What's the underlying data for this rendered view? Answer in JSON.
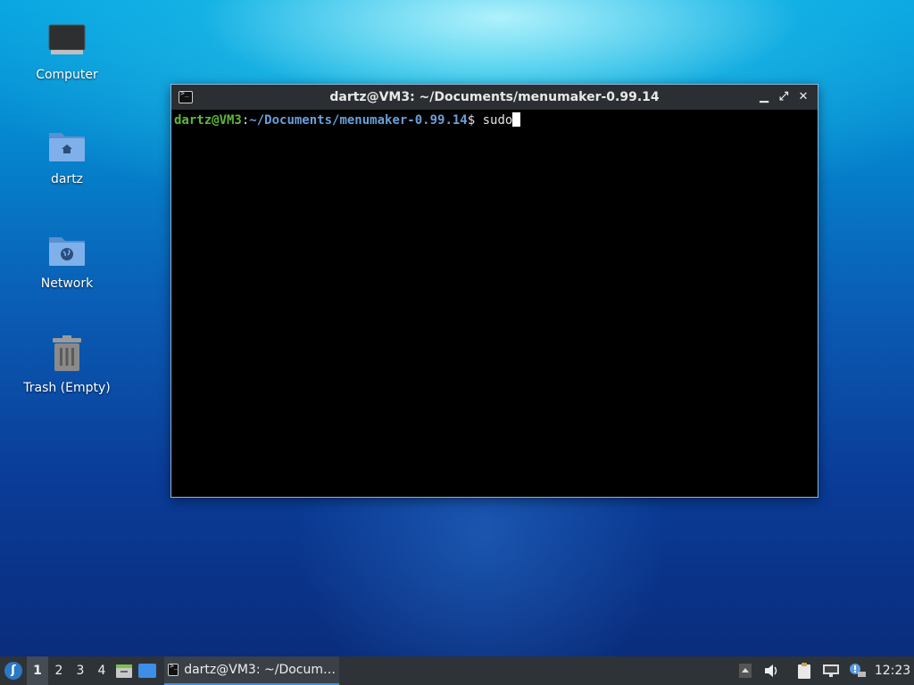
{
  "desktop": {
    "icons": [
      {
        "label": "Computer",
        "icon": "computer-icon"
      },
      {
        "label": "dartz",
        "icon": "home-folder-icon"
      },
      {
        "label": "Network",
        "icon": "network-folder-icon"
      },
      {
        "label": "Trash (Empty)",
        "icon": "trash-icon"
      }
    ]
  },
  "window": {
    "title": "dartz@VM3: ~/Documents/menumaker-0.99.14",
    "controls": {
      "minimize": "▁",
      "maximize": "⤢",
      "close": "✕"
    },
    "terminal": {
      "user_host": "dartz@VM3",
      "separator": ":",
      "path": "~/Documents/menumaker-0.99.14",
      "prompt_symbol": "$ ",
      "input": "sudo"
    }
  },
  "taskbar": {
    "workspaces": [
      "1",
      "2",
      "3",
      "4"
    ],
    "active_workspace": "1",
    "task_label": "dartz@VM3: ~/Docum…",
    "clock": "12:23"
  },
  "colors": {
    "prompt_user": "#5fb63a",
    "prompt_path": "#6a9fd8",
    "taskbar_bg": "#2e3338",
    "titlebar_bg": "#2b2f33",
    "accent": "#3d8ee6"
  }
}
